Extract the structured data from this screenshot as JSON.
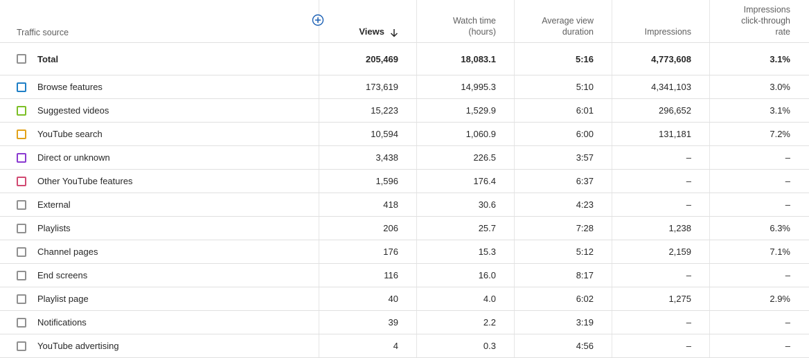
{
  "header": {
    "traffic_source": "Traffic source",
    "views": "Views",
    "watch_time_line1": "Watch time",
    "watch_time_line2": "(hours)",
    "avg_view_line1": "Average view",
    "avg_view_line2": "duration",
    "impressions": "Impressions",
    "ctr_line1": "Impressions",
    "ctr_line2": "click-through",
    "ctr_line3": "rate",
    "add_icon": "add-circle-icon",
    "sort_icon": "arrow-down-icon"
  },
  "total": {
    "label": "Total",
    "views": "205,469",
    "watch_time": "18,083.1",
    "avg_duration": "5:16",
    "impressions": "4,773,608",
    "ctr": "3.1%"
  },
  "rows": [
    {
      "label": "Browse features",
      "color": "#1f7fc6",
      "views": "173,619",
      "watch_time": "14,995.3",
      "avg_duration": "5:10",
      "impressions": "4,341,103",
      "ctr": "3.0%"
    },
    {
      "label": "Suggested videos",
      "color": "#7cbf26",
      "views": "15,223",
      "watch_time": "1,529.9",
      "avg_duration": "6:01",
      "impressions": "296,652",
      "ctr": "3.1%"
    },
    {
      "label": "YouTube search",
      "color": "#e2a21a",
      "views": "10,594",
      "watch_time": "1,060.9",
      "avg_duration": "6:00",
      "impressions": "131,181",
      "ctr": "7.2%"
    },
    {
      "label": "Direct or unknown",
      "color": "#8a3ad0",
      "views": "3,438",
      "watch_time": "226.5",
      "avg_duration": "3:57",
      "impressions": "–",
      "ctr": "–"
    },
    {
      "label": "Other YouTube features",
      "color": "#d14a72",
      "views": "1,596",
      "watch_time": "176.4",
      "avg_duration": "6:37",
      "impressions": "–",
      "ctr": "–"
    },
    {
      "label": "External",
      "color": "#909090",
      "views": "418",
      "watch_time": "30.6",
      "avg_duration": "4:23",
      "impressions": "–",
      "ctr": "–"
    },
    {
      "label": "Playlists",
      "color": "#909090",
      "views": "206",
      "watch_time": "25.7",
      "avg_duration": "7:28",
      "impressions": "1,238",
      "ctr": "6.3%"
    },
    {
      "label": "Channel pages",
      "color": "#909090",
      "views": "176",
      "watch_time": "15.3",
      "avg_duration": "5:12",
      "impressions": "2,159",
      "ctr": "7.1%"
    },
    {
      "label": "End screens",
      "color": "#909090",
      "views": "116",
      "watch_time": "16.0",
      "avg_duration": "8:17",
      "impressions": "–",
      "ctr": "–"
    },
    {
      "label": "Playlist page",
      "color": "#909090",
      "views": "40",
      "watch_time": "4.0",
      "avg_duration": "6:02",
      "impressions": "1,275",
      "ctr": "2.9%"
    },
    {
      "label": "Notifications",
      "color": "#909090",
      "views": "39",
      "watch_time": "2.2",
      "avg_duration": "3:19",
      "impressions": "–",
      "ctr": "–"
    },
    {
      "label": "YouTube advertising",
      "color": "#909090",
      "views": "4",
      "watch_time": "0.3",
      "avg_duration": "4:56",
      "impressions": "–",
      "ctr": "–"
    }
  ]
}
